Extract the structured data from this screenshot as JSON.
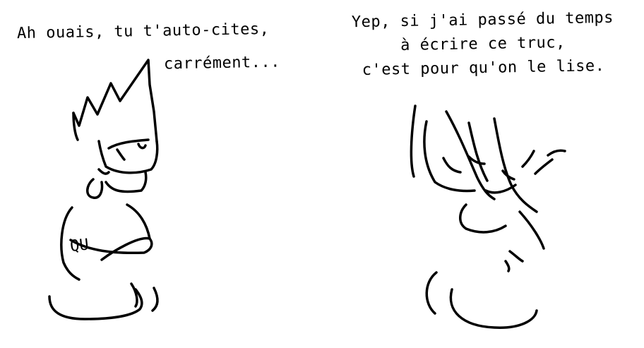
{
  "comic": {
    "left_speech": {
      "line1": "Ah ouais, tu t'auto-cites,",
      "line2": "carrément..."
    },
    "right_speech": {
      "line1": "Yep, si j'ai passé du temps",
      "line2": "à écrire ce truc,",
      "line3": "c'est pour qu'on le lise."
    },
    "arm_lettering": "QU"
  },
  "colors": {
    "ink": "#000000",
    "paper": "#ffffff"
  }
}
